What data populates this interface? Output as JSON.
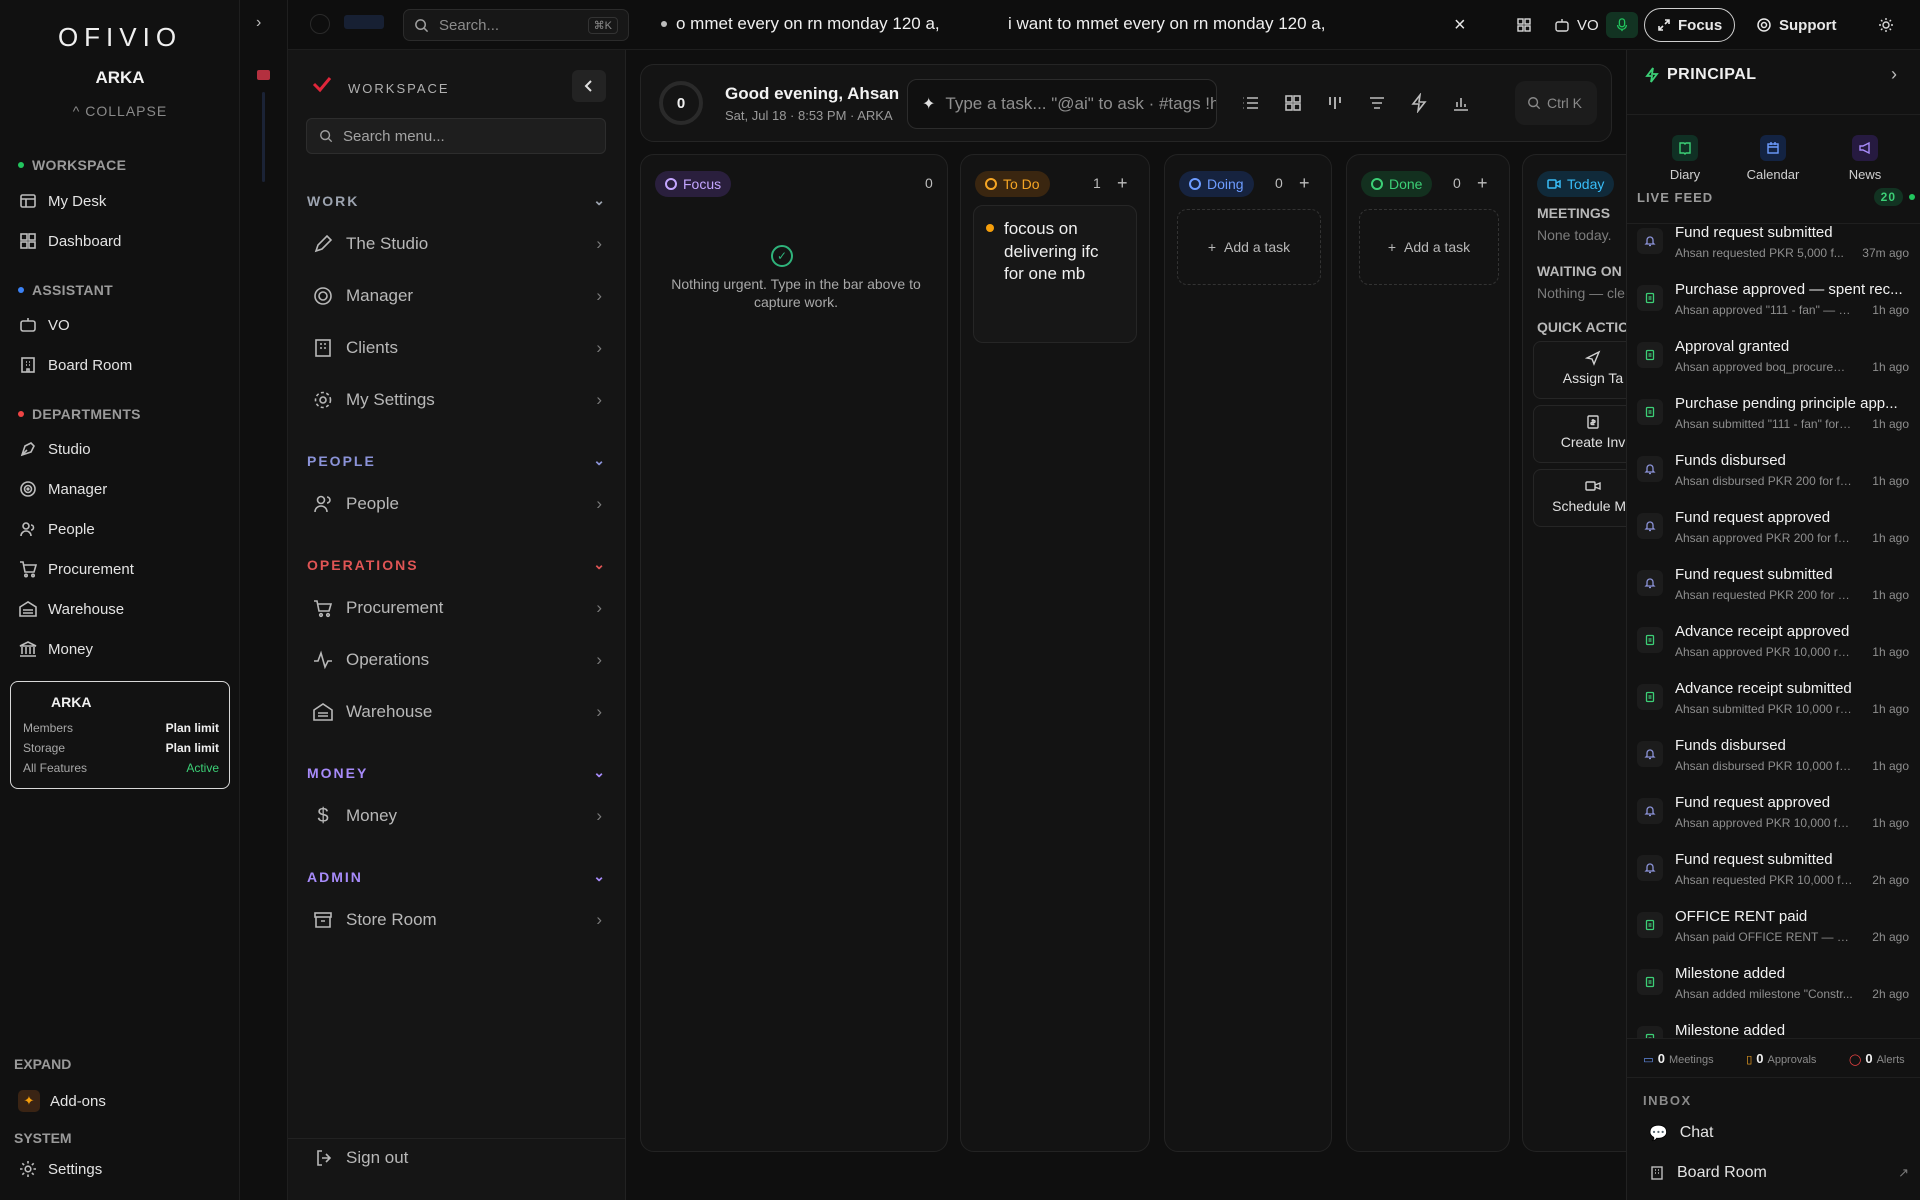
{
  "brand": {
    "logo": "OFIVIO",
    "org": "ARKA",
    "collapse": "COLLAPSE"
  },
  "sidebar": {
    "workspace_head": "WORKSPACE",
    "workspace_items": [
      {
        "label": "My Desk",
        "icon": "desk-icon"
      },
      {
        "label": "Dashboard",
        "icon": "grid-icon"
      }
    ],
    "assistant_head": "ASSISTANT",
    "assistant_items": [
      {
        "label": "VO",
        "icon": "robot-icon"
      },
      {
        "label": "Board Room",
        "icon": "building-icon"
      }
    ],
    "departments_head": "DEPARTMENTS",
    "department_items": [
      {
        "label": "Studio",
        "icon": "pen-tool-icon"
      },
      {
        "label": "Manager",
        "icon": "target-icon"
      },
      {
        "label": "People",
        "icon": "users-icon"
      },
      {
        "label": "Procurement",
        "icon": "cart-icon"
      },
      {
        "label": "Warehouse",
        "icon": "warehouse-icon"
      },
      {
        "label": "Money",
        "icon": "bank-icon"
      }
    ],
    "plan": {
      "title": "ARKA",
      "rows": [
        {
          "k": "Members",
          "v": "Plan limit"
        },
        {
          "k": "Storage",
          "v": "Plan limit"
        },
        {
          "k": "All Features",
          "v": "Active"
        }
      ]
    },
    "expand_head": "EXPAND",
    "addons": "Add-ons",
    "system_head": "SYSTEM",
    "settings": "Settings",
    "colors": {
      "workspace_dot": "#22c55e",
      "assistant_dot": "#3b82f6",
      "departments_dot": "#ef4444",
      "active": "#3ccf76"
    }
  },
  "topbar": {
    "search_placeholder": "Search...",
    "search_kbd": "⌘K",
    "ticker_1": "o mmet every on rn monday 120 a,",
    "ticker_2": "i want to mmet every on rn monday 120 a,",
    "close": "×",
    "vo": "VO",
    "focus": "Focus",
    "support": "Support"
  },
  "workspace_menu": {
    "title": "WORKSPACE",
    "search_placeholder": "Search menu...",
    "groups": [
      {
        "head": "WORK",
        "color": "#9ca3af",
        "items": [
          "The Studio",
          "Manager",
          "Clients",
          "My Settings"
        ]
      },
      {
        "head": "PEOPLE",
        "color": "#8b93d8",
        "items": [
          "People"
        ]
      },
      {
        "head": "OPERATIONS",
        "color": "#e05555",
        "items": [
          "Procurement",
          "Operations",
          "Warehouse"
        ]
      },
      {
        "head": "MONEY",
        "color": "#a78bfa",
        "items": [
          "Money"
        ]
      },
      {
        "head": "ADMIN",
        "color": "#a78bfa",
        "items": [
          "Store Room"
        ]
      }
    ],
    "sign_out": "Sign out"
  },
  "main": {
    "score": "0",
    "greeting": "Good evening, Ahsan",
    "date_line": "Sat, Jul 18 · 8:53 PM · ARKA",
    "task_placeholder": "Type a task... \"@ai\" to ask · #tags !h",
    "ctrlk": "Ctrl K",
    "columns": {
      "focus": {
        "label": "Focus",
        "count": "0",
        "empty": "Nothing urgent. Type in the bar above to capture work."
      },
      "todo": {
        "label": "To Do",
        "count": "1",
        "card": "focous on delivering ifc for one mb"
      },
      "doing": {
        "label": "Doing",
        "count": "0",
        "add": "Add a task"
      },
      "done": {
        "label": "Done",
        "count": "0",
        "add": "Add a task"
      },
      "today": {
        "label": "Today",
        "meetings_head": "MEETINGS",
        "meetings_sub": "None today.",
        "waiting_head": "WAITING ON",
        "waiting_sub": "Nothing — cle",
        "quick_head": "QUICK ACTIO",
        "actions": [
          "Assign Ta",
          "Create Inv",
          "Schedule Me"
        ]
      }
    }
  },
  "right_panel": {
    "title": "PRINCIPAL",
    "tabs": [
      "Diary",
      "Calendar",
      "News"
    ],
    "live_feed": "LIVE FEED",
    "live_count": "20",
    "feed": [
      {
        "t": "Fund request submitted",
        "s": "Ahsan requested PKR 5,000 f...",
        "a": "37m ago",
        "icon": "bell-icon"
      },
      {
        "t": "Purchase approved — spent rec...",
        "s": "Ahsan approved \"111 - fan\" — PKR ...",
        "a": "1h ago",
        "icon": "document-icon"
      },
      {
        "t": "Approval granted",
        "s": "Ahsan approved boq_procurem...",
        "a": "1h ago",
        "icon": "document-icon"
      },
      {
        "t": "Purchase pending principle app...",
        "s": "Ahsan submitted \"111 - fan\" for pri...",
        "a": "1h ago",
        "icon": "document-icon"
      },
      {
        "t": "Funds disbursed",
        "s": "Ahsan disbursed PKR 200 for fans",
        "a": "1h ago",
        "icon": "bell-icon"
      },
      {
        "t": "Fund request approved",
        "s": "Ahsan approved PKR 200 for fans",
        "a": "1h ago",
        "icon": "bell-icon"
      },
      {
        "t": "Fund request submitted",
        "s": "Ahsan requested PKR 200 for fans",
        "a": "1h ago",
        "icon": "bell-icon"
      },
      {
        "t": "Advance receipt approved",
        "s": "Ahsan approved PKR 10,000 rec...",
        "a": "1h ago",
        "icon": "document-icon"
      },
      {
        "t": "Advance receipt submitted",
        "s": "Ahsan submitted PKR 10,000 re...",
        "a": "1h ago",
        "icon": "document-icon"
      },
      {
        "t": "Funds disbursed",
        "s": "Ahsan disbursed PKR 10,000 for ...",
        "a": "1h ago",
        "icon": "bell-icon"
      },
      {
        "t": "Fund request approved",
        "s": "Ahsan approved PKR 10,000 for ...",
        "a": "1h ago",
        "icon": "bell-icon"
      },
      {
        "t": "Fund request submitted",
        "s": "Ahsan requested PKR 10,000 fo...",
        "a": "2h ago",
        "icon": "bell-icon"
      },
      {
        "t": "OFFICE RENT paid",
        "s": "Ahsan paid OFFICE RENT — PKR ...",
        "a": "2h ago",
        "icon": "document-icon"
      },
      {
        "t": "Milestone added",
        "s": "Ahsan added milestone \"Constr...",
        "a": "2h ago",
        "icon": "document-icon"
      },
      {
        "t": "Milestone added",
        "s": "",
        "a": "",
        "icon": "document-icon"
      }
    ],
    "stats": [
      {
        "n": "0",
        "l": "Meetings"
      },
      {
        "n": "0",
        "l": "Approvals"
      },
      {
        "n": "0",
        "l": "Alerts"
      }
    ],
    "inbox_head": "INBOX",
    "inbox": [
      "Chat",
      "Board Room"
    ]
  }
}
